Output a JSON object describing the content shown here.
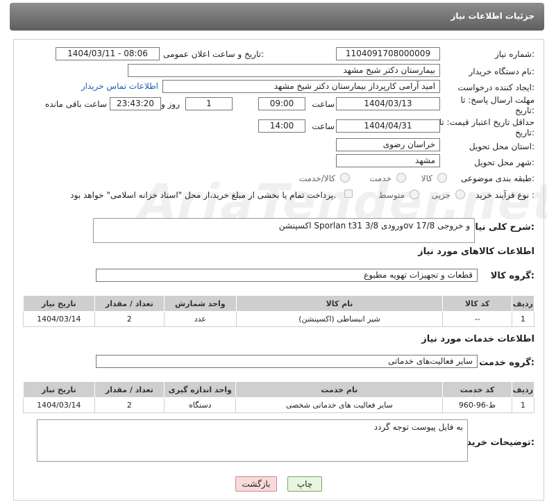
{
  "header": {
    "title": "جزئیات اطلاعات نیاز"
  },
  "form": {
    "need_number_label": "شماره نیاز:",
    "need_number": "1104091708000009",
    "announce_label": "تاریخ و ساعت اعلان عمومی:",
    "announce_value": "1404/03/11 - 08:06",
    "buyer_org_label": "نام دستگاه خریدار:",
    "buyer_org": "بیمارستان دکتر شیخ مشهد",
    "creator_label": "ایجاد کننده درخواست:",
    "creator": "امید آرامی کارپرداز بیمارستان دکتر شیخ مشهد",
    "contact_link": "اطلاعات تماس خریدار",
    "deadline_label": "مهلت ارسال پاسخ: تا تاریخ:",
    "deadline_date": "1404/03/13",
    "hour_label": "ساعت",
    "deadline_time": "09:00",
    "days_value": "1",
    "day_and_label": "روز و",
    "remaining_time": "23:43:20",
    "remaining_label": "ساعت باقی مانده",
    "validity_label": "حداقل تاریخ اعتبار قیمت: تا تاریخ:",
    "validity_date": "1404/04/31",
    "validity_time": "14:00",
    "province_label": "استان محل تحویل:",
    "province": "خراسان رضوی",
    "city_label": "شهر محل تحویل:",
    "city": "مشهد",
    "category_label": "طبقه بندی موضوعی:",
    "category_options": [
      "کالا",
      "خدمت",
      "کالا/خدمت"
    ],
    "process_label": "نوع فرآیند خرید :",
    "process_options": [
      "جزیی",
      "متوسط"
    ],
    "payment_note": "پرداخت تمام یا بخشی از مبلغ خرید،از محل \"اسناد خزانه اسلامی\" خواهد بود.",
    "summary_label": "شرح کلی نیاز:",
    "summary": "اکسپنشن Sporlan t31 ورودی 3/8ov 1و خروجی 7/8"
  },
  "goods": {
    "section_title": "اطلاعات کالاهای مورد نیاز",
    "group_label": "گروه کالا:",
    "group_value": "قطعات و تجهیزات تهویه مطبوع",
    "columns": [
      "ردیف",
      "کد کالا",
      "نام کالا",
      "واحد شمارش",
      "تعداد / مقدار",
      "تاریخ نیاز"
    ],
    "rows": [
      [
        "1",
        "--",
        "شیر انبساطی (اکسپنشن)",
        "عدد",
        "2",
        "1404/03/14"
      ]
    ]
  },
  "services": {
    "section_title": "اطلاعات خدمات مورد نیاز",
    "group_label": "گروه خدمت:",
    "group_value": "سایر فعالیت‌های خدماتی",
    "columns": [
      "ردیف",
      "کد خدمت",
      "نام خدمت",
      "واحد اندازه گیری",
      "تعداد / مقدار",
      "تاریخ نیاز"
    ],
    "rows": [
      [
        "1",
        "ط-96-960",
        "سایر فعالیت های خدماتی شخصی",
        "دستگاه",
        "2",
        "1404/03/14"
      ]
    ]
  },
  "notes": {
    "label": "توضیحات خریدار:",
    "value": "به فایل پیوست توجه گردد"
  },
  "buttons": {
    "print": "چاپ",
    "back": "بازگشت"
  },
  "watermark": "AriaTender.net"
}
